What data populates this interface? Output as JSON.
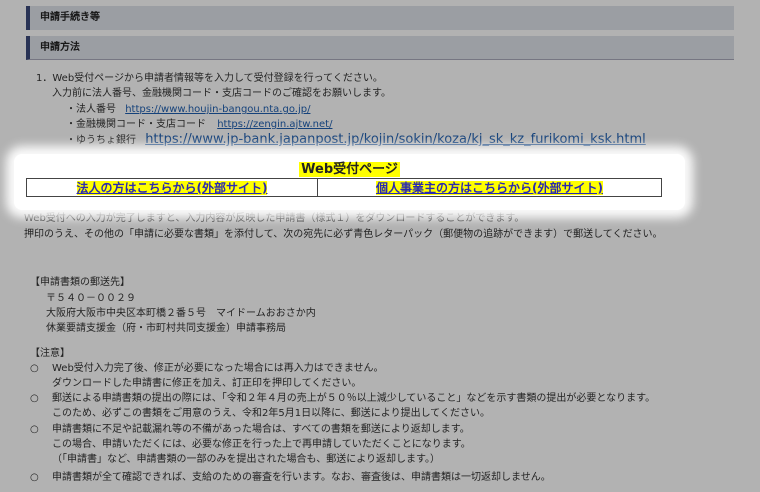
{
  "headers": {
    "section": "申請手続き等",
    "subsection": "申請方法"
  },
  "step1": {
    "line1": "1．Web受付ページから申請者情報等を入力して受付登録を行ってください。",
    "line2": "入力前に法人番号、金融機関コード・支店コードのご確認をお願いします。",
    "items": [
      {
        "label": "・法人番号",
        "url": "https://www.houjin-bangou.nta.go.jp/"
      },
      {
        "label": "・金融機関コード・支店コード",
        "url": "https://zengin.ajtw.net/"
      },
      {
        "label": "・ゆうちょ銀行",
        "url": "https://www.jp-bank.japanpost.jp/kojin/sokin/koza/kj_sk_kz_furikomi_ksk.html"
      }
    ]
  },
  "web": {
    "title": "Web受付ページ",
    "corporate": "法人の方はこちらから(外部サイト)",
    "individual": "個人事業主の方はこちらから(外部サイト)"
  },
  "after": {
    "line1": "Web受付への入力が完了しますと、入力内容が反映した申請書（様式１）をダウンロードすることができます。",
    "line2": "押印のうえ、その他の「申請に必要な書類」を添付して、次の宛先に必ず青色レターパック（郵便物の追跡ができます）で郵送してください。"
  },
  "address": {
    "heading": "【申請書類の郵送先】",
    "postal": "〒５４０－００２９",
    "street": "大阪府大阪市中央区本町橋２番５号　マイドームおおさか内",
    "office": "休業要請支援金（府・市町村共同支援金）申請事務局"
  },
  "notes": {
    "heading": "【注意】",
    "items": [
      {
        "bullet": "○",
        "lines": [
          "Web受付入力完了後、修正が必要になった場合には再入力はできません。",
          "ダウンロードした申請書に修正を加え、訂正印を押印してください。"
        ]
      },
      {
        "bullet": "○",
        "lines": [
          "郵送による申請書類の提出の際には、「令和２年４月の売上が５０％以上減少していること」などを示す書類の提出が必要となります。",
          "このため、必ずこの書類をご用意のうえ、令和2年5月1日以降に、郵送により提出してください。"
        ]
      },
      {
        "bullet": "○",
        "lines": [
          "申請書類に不足や記載漏れ等の不備があった場合は、すべての書類を郵送により返却します。",
          "この場合、申請いただくには、必要な修正を行った上で再申請していただくことになります。",
          "（「申請書」など、申請書類の一部のみを提出された場合も、郵送により返却します。）"
        ]
      },
      {
        "bullet": "○",
        "lines": [
          "申請書類が全て確認できれば、支給のための審査を行います。なお、審査後は、申請書類は一切返却しません。"
        ]
      }
    ]
  }
}
